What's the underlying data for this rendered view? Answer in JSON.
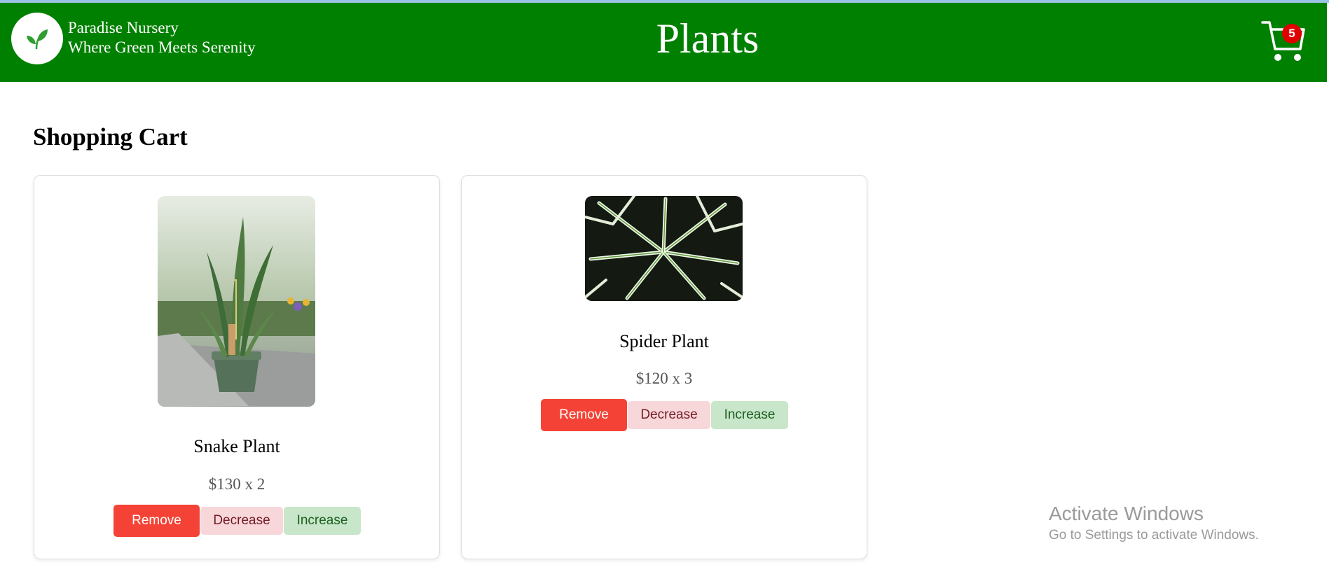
{
  "header": {
    "brand_name": "Paradise Nursery",
    "tagline": "Where Green Meets Serenity",
    "title": "Plants",
    "cart_count": "5",
    "colors": {
      "navbar": "#008000",
      "badge": "#e00000"
    }
  },
  "cart": {
    "heading": "Shopping Cart",
    "items": [
      {
        "name": "Snake Plant",
        "price_line": "$130 x 2",
        "image": "snake-plant-photo",
        "remove_label": "Remove",
        "decrease_label": "Decrease",
        "increase_label": "Increase"
      },
      {
        "name": "Spider Plant",
        "price_line": "$120 x 3",
        "image": "spider-plant-photo",
        "remove_label": "Remove",
        "decrease_label": "Decrease",
        "increase_label": "Increase"
      }
    ],
    "button_colors": {
      "remove": "#f44336",
      "decrease": "#f8d7da",
      "increase": "#c8e6c9"
    }
  },
  "watermark": {
    "title": "Activate Windows",
    "subtitle": "Go to Settings to activate Windows."
  }
}
